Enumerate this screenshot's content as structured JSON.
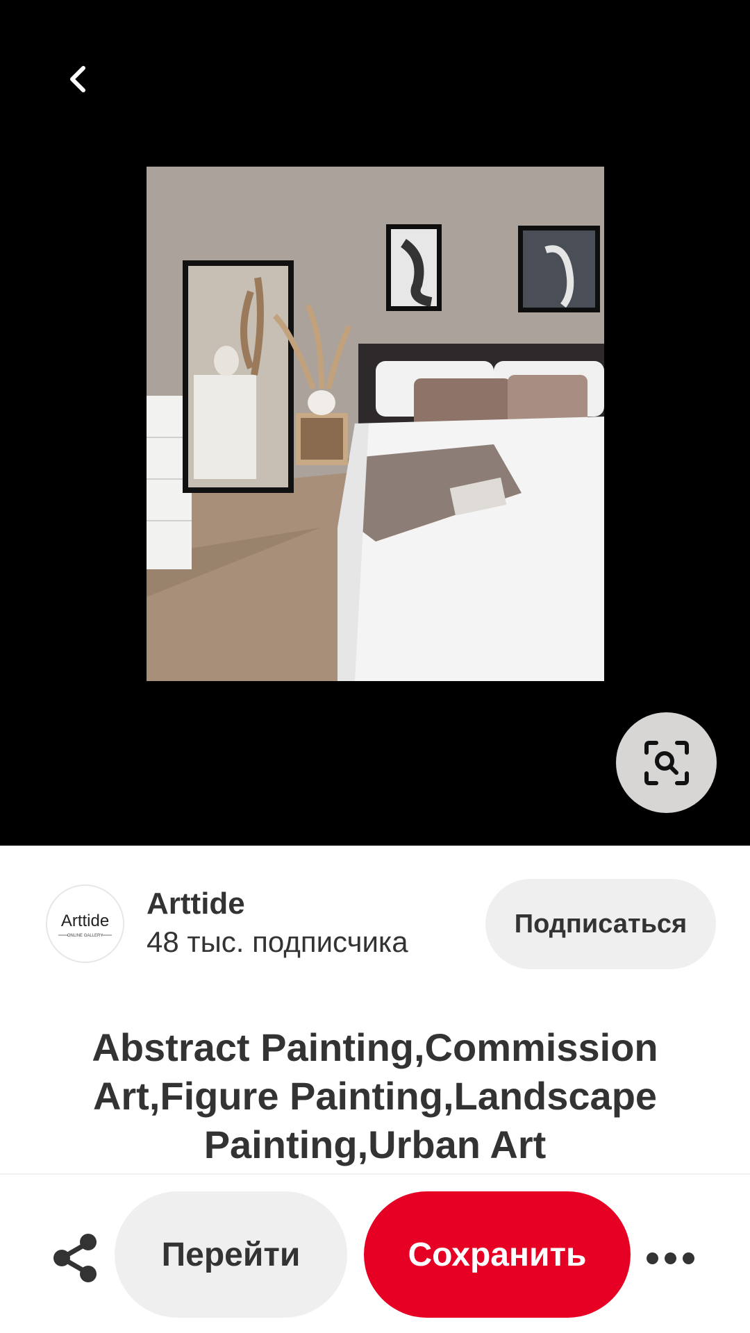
{
  "colors": {
    "media_background": "#000000",
    "text_primary": "#333333",
    "secondary_button": "#efefef",
    "save_button": "#e60023",
    "save_text": "#ffffff"
  },
  "icons": {
    "back": "chevron-left-icon",
    "visual_search": "visual-search-icon",
    "share": "share-icon",
    "more": "more-horizontal-icon"
  },
  "creator": {
    "logo_text": "Arttide",
    "logo_subtext": "ONLINE GALLERY",
    "name": "Arttide",
    "followers": "48 тыс. подписчика",
    "follow_label": "Подписаться"
  },
  "pin": {
    "title": "Abstract Painting,Commission Art,Figure Painting,Landscape Painting,Urban Art"
  },
  "actions": {
    "visit_label": "Перейти",
    "save_label": "Сохранить"
  }
}
